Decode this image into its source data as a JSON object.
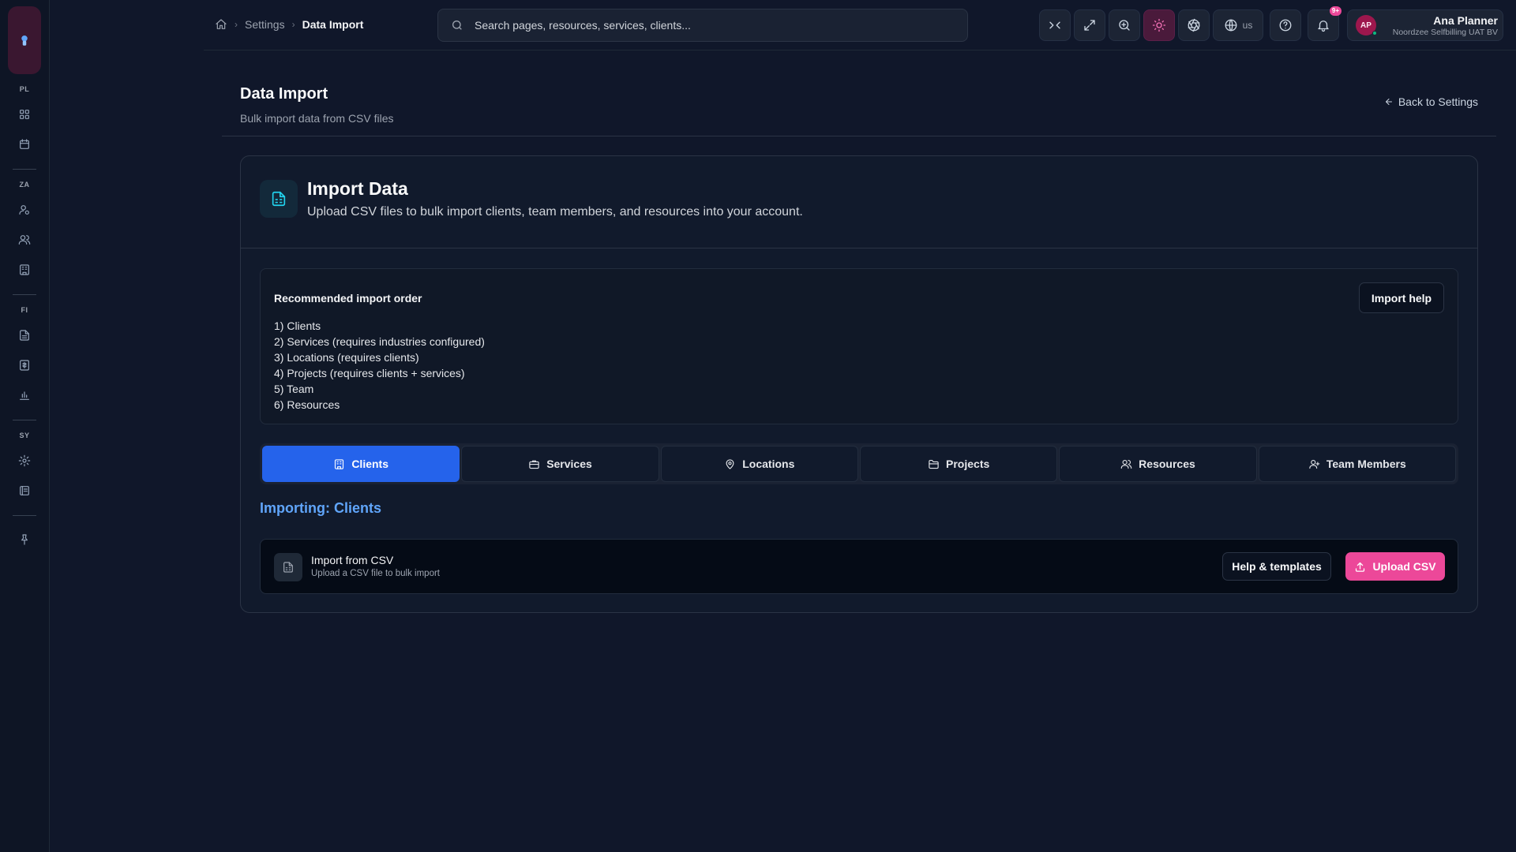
{
  "sidebar": {
    "sections": [
      "PL",
      "ZA",
      "FI",
      "SY"
    ],
    "icons": [
      "dashboard-icon",
      "calendar-icon",
      "user-settings-icon",
      "users-icon",
      "building-icon",
      "document-icon",
      "invoice-icon",
      "chart-icon",
      "gear-icon",
      "ledger-icon",
      "pin-icon"
    ]
  },
  "breadcrumb": {
    "items": [
      "Settings",
      "Data Import"
    ]
  },
  "search": {
    "placeholder": "Search pages, resources, services, clients..."
  },
  "topbar": {
    "language": "us",
    "notifications_badge": "9+",
    "accent_color": "#ec4899"
  },
  "user": {
    "initials": "AP",
    "name": "Ana Planner",
    "org": "Noordzee Selfbilling UAT BV"
  },
  "page": {
    "title": "Data Import",
    "subtitle": "Bulk import data from CSV files",
    "back_label": "Back to Settings"
  },
  "card": {
    "title": "Import Data",
    "subtitle": "Upload CSV files to bulk import clients, team members, and resources into your account."
  },
  "recommended": {
    "title": "Recommended import order",
    "help_label": "Import help",
    "items": [
      "1) Clients",
      "2) Services (requires industries configured)",
      "3) Locations (requires clients)",
      "4) Projects (requires clients + services)",
      "5) Team",
      "6) Resources"
    ]
  },
  "tabs": [
    {
      "label": "Clients",
      "icon": "building-icon",
      "active": true
    },
    {
      "label": "Services",
      "icon": "briefcase-icon",
      "active": false
    },
    {
      "label": "Locations",
      "icon": "map-pin-icon",
      "active": false
    },
    {
      "label": "Projects",
      "icon": "folder-icon",
      "active": false
    },
    {
      "label": "Resources",
      "icon": "users-icon",
      "active": false
    },
    {
      "label": "Team Members",
      "icon": "user-plus-icon",
      "active": false
    }
  ],
  "importing": {
    "label": "Importing: Clients"
  },
  "csv": {
    "title": "Import from CSV",
    "subtitle": "Upload a CSV file to bulk import",
    "templates_label": "Help & templates",
    "upload_label": "Upload CSV"
  }
}
